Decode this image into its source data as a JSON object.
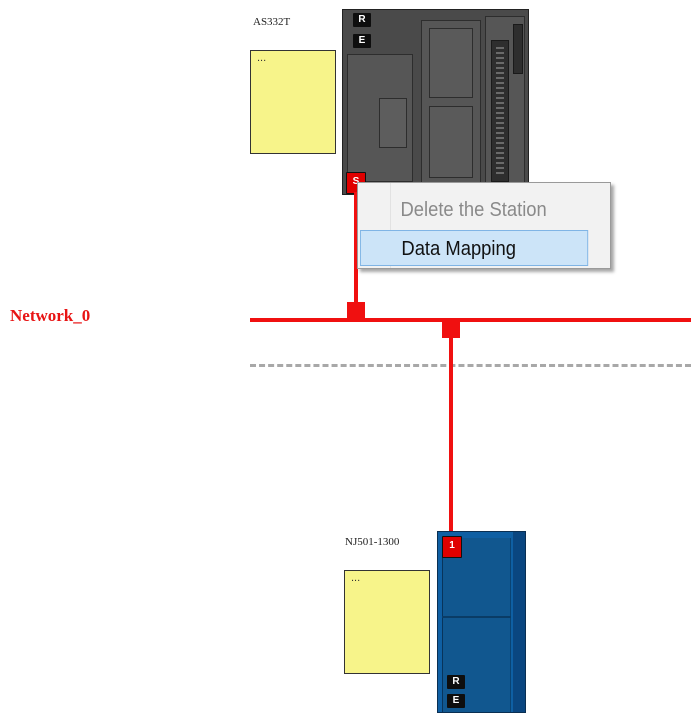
{
  "devices": {
    "plc_top": {
      "label": "AS332T",
      "note": "...",
      "status_tags": [
        "R",
        "E"
      ],
      "port_tag": "S"
    },
    "plc_bottom": {
      "label": "NJ501-1300",
      "note": "...",
      "port_tag": "1",
      "status_tags": [
        "R",
        "E"
      ]
    }
  },
  "network": {
    "name": "Network_0",
    "color": "#f01010"
  },
  "context_menu": {
    "items": [
      {
        "label": "Delete the Station",
        "state": "disabled"
      },
      {
        "label": "Data Mapping",
        "state": "highlighted"
      }
    ]
  },
  "colors": {
    "note_bg": "#f7f48a",
    "network": "#f01010",
    "plc_top_body": "#4a4a4a",
    "plc_bottom_body": "#0f5fa3",
    "menu_highlight": "#cce4f8"
  }
}
